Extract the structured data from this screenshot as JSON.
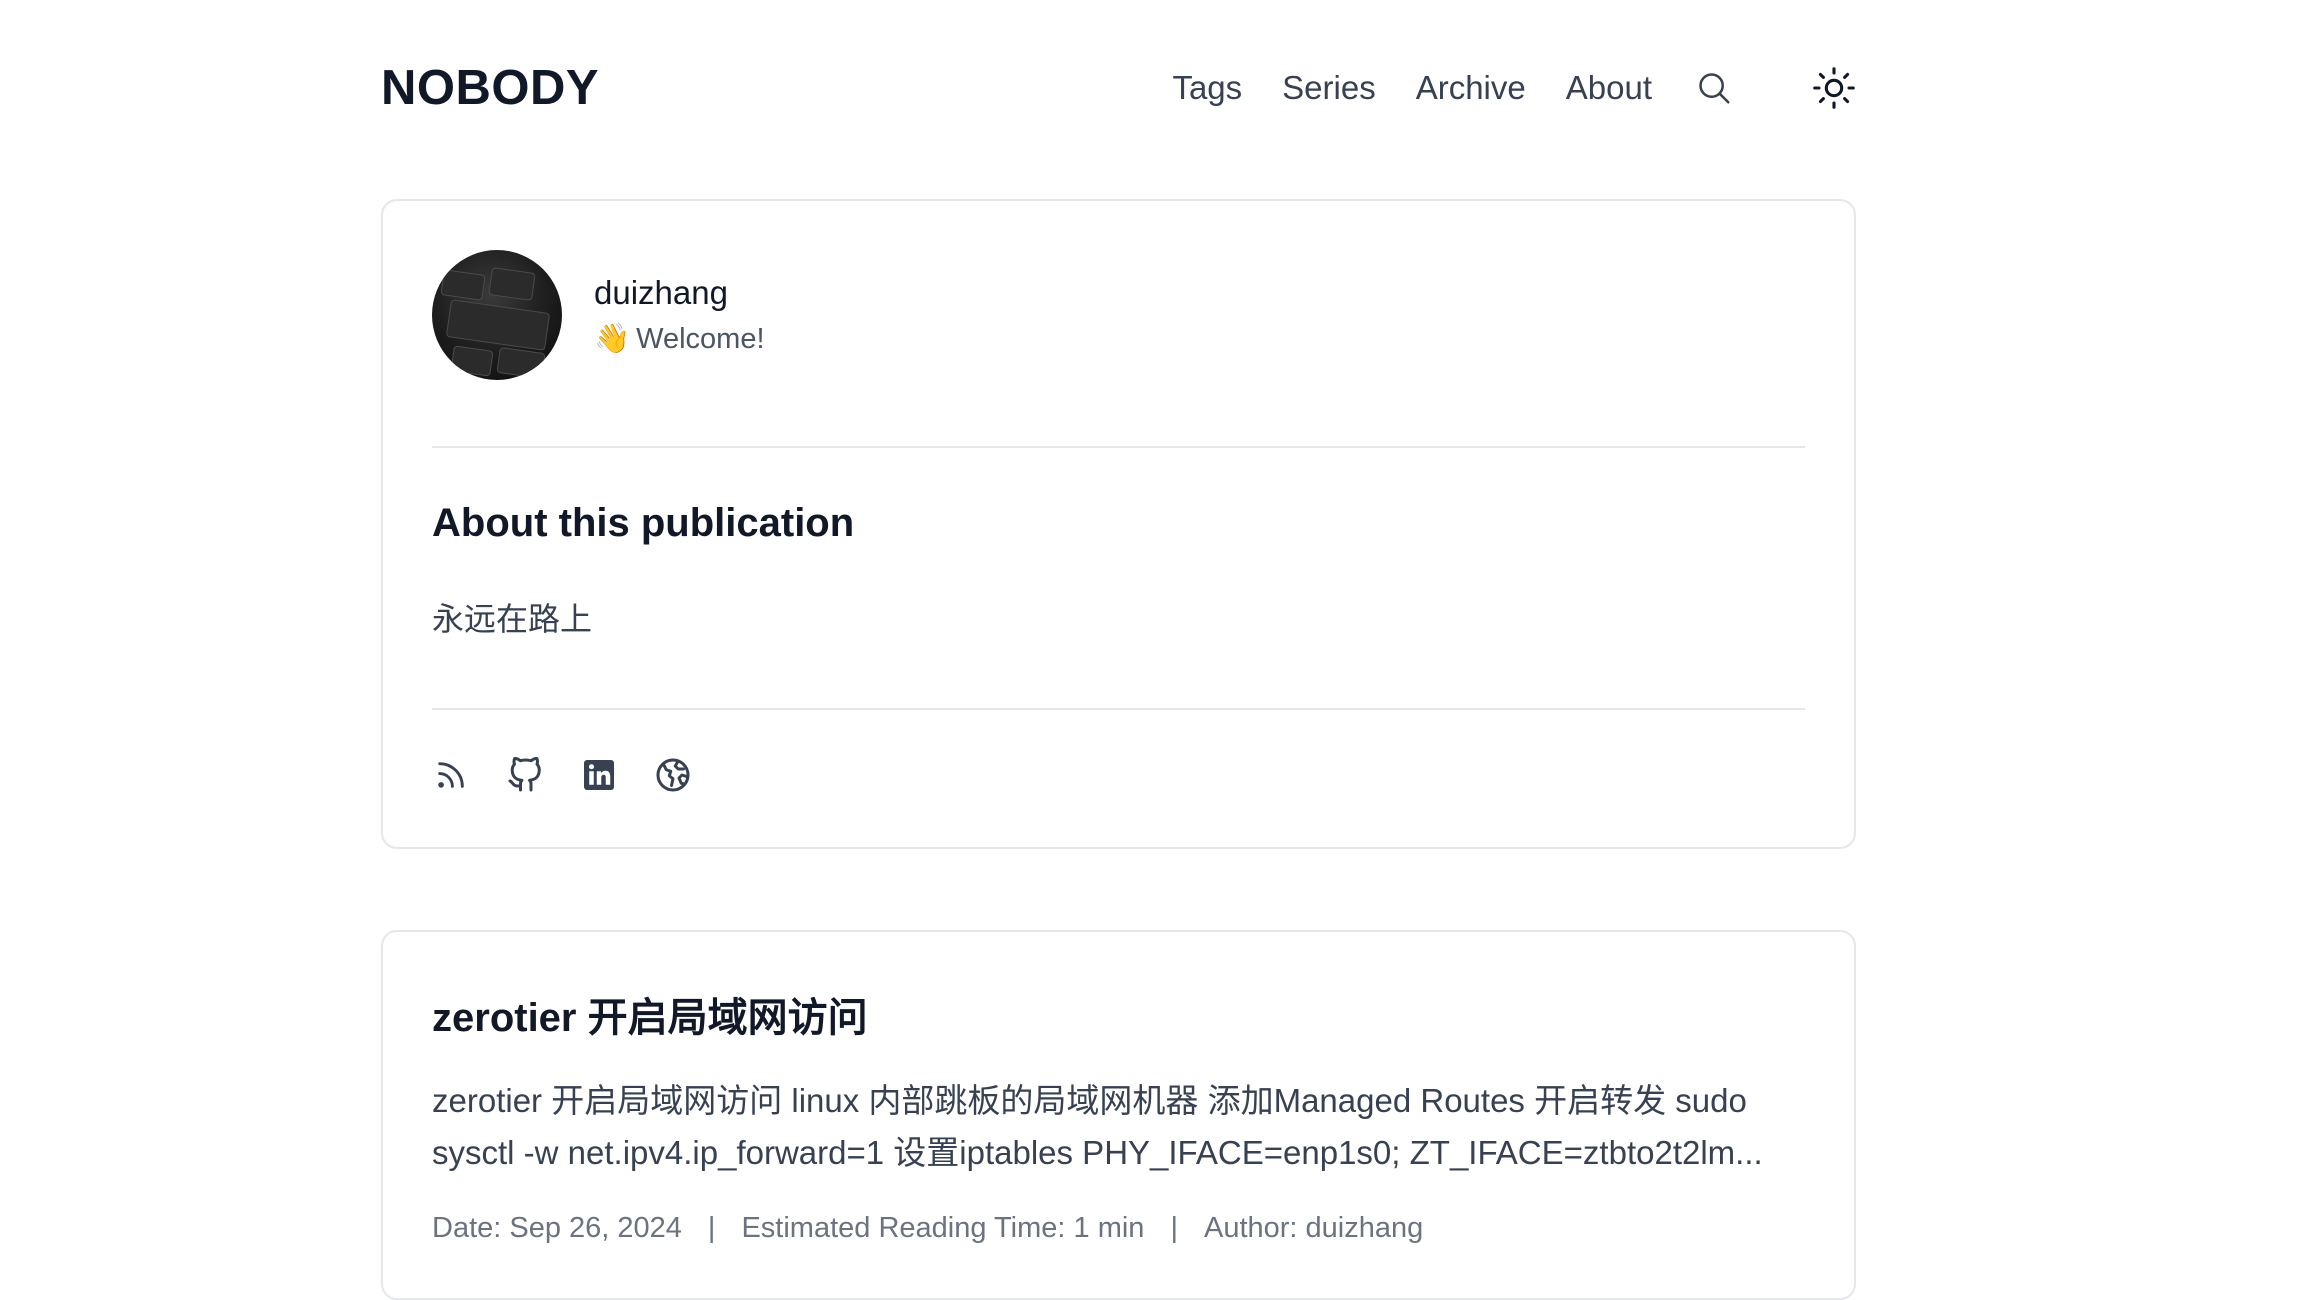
{
  "site": {
    "logo": "NOBODY"
  },
  "nav": {
    "items": [
      {
        "label": "Tags"
      },
      {
        "label": "Series"
      },
      {
        "label": "Archive"
      },
      {
        "label": "About"
      }
    ],
    "search_icon": "search-icon",
    "theme_icon": "sun-icon"
  },
  "profile": {
    "name": "duizhang",
    "greeting_emoji": "👋",
    "greeting": "Welcome!",
    "about_title": "About this publication",
    "about_desc": "永远在路上",
    "social_icons": [
      "rss-icon",
      "github-icon",
      "linkedin-icon",
      "globe-icon"
    ]
  },
  "post": {
    "title": "zerotier 开启局域网访问",
    "summary": "zerotier 开启局域网访问 linux 内部跳板的局域网机器 添加Managed Routes 开启转发 sudo sysctl -w net.ipv4.ip_forward=1 设置iptables PHY_IFACE=enp1s0; ZT_IFACE=ztbto2t2lm...",
    "date": "Date: Sep 26, 2024",
    "sep": "|",
    "reading_time": "Estimated Reading Time: 1 min",
    "author": "Author: duizhang"
  },
  "colors": {
    "text_primary": "#111827",
    "text_secondary": "#374151",
    "text_muted": "#6b7280",
    "border": "#e5e7eb"
  }
}
